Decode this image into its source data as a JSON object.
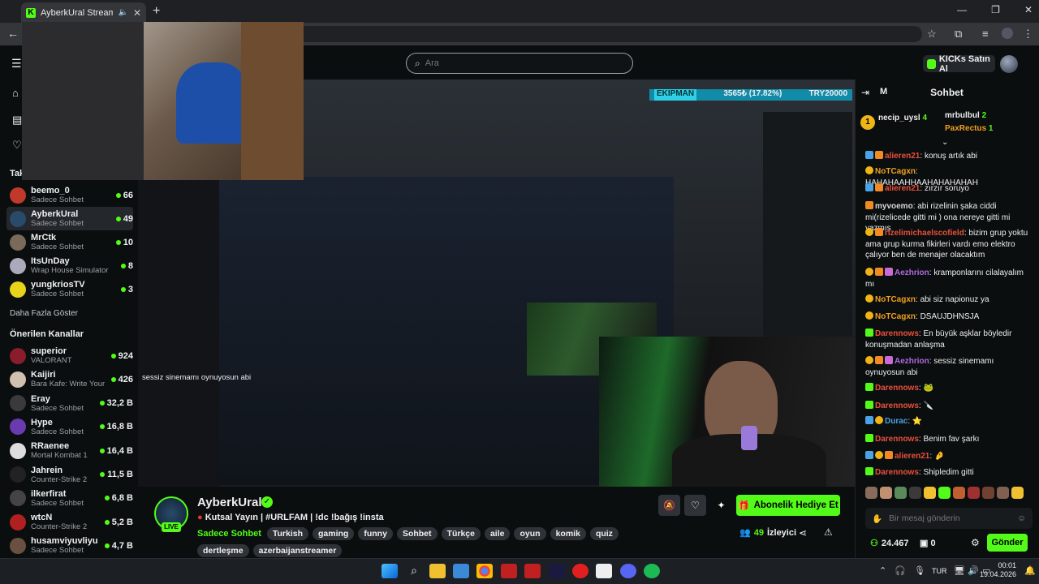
{
  "browser": {
    "tab_title": "AyberkUral Stream - Watch",
    "tab_favicon": "K",
    "new_tab": "+"
  },
  "header": {
    "search_placeholder": "Ara",
    "kicks_label": "KICKs Satın Al"
  },
  "sidebar": {
    "following_title": "Tak",
    "following": [
      {
        "name": "beemo_0",
        "sub": "Sadece Sohbet",
        "viewers": "66",
        "color": "#c0392b"
      },
      {
        "name": "AyberkUral",
        "sub": "Sadece Sohbet",
        "viewers": "49",
        "color": "#2a4a6a"
      },
      {
        "name": "MrCtk",
        "sub": "Sadece Sohbet",
        "viewers": "10",
        "color": "#7a6a5a"
      },
      {
        "name": "ItsUnDay",
        "sub": "Wrap House Simulator",
        "viewers": "8",
        "color": "#aab"
      },
      {
        "name": "yungkriosTV",
        "sub": "Sadece Sohbet",
        "viewers": "3",
        "color": "#e8d21a"
      }
    ],
    "show_more": "Daha Fazla Göster",
    "recommended_title": "Önerilen Kanallar",
    "recommended": [
      {
        "name": "superior",
        "sub": "VALORANT",
        "viewers": "924",
        "color": "#8a1c2c"
      },
      {
        "name": "Kaijiri",
        "sub": "Bara Kafe: Write Your ...",
        "viewers": "426",
        "color": "#cfc0b0"
      },
      {
        "name": "Eray",
        "sub": "Sadece Sohbet",
        "viewers": "32,2 B",
        "color": "#3a3a3a"
      },
      {
        "name": "Hype",
        "sub": "Sadece Sohbet",
        "viewers": "16,8 B",
        "color": "#6a3ab0"
      },
      {
        "name": "RRaenee",
        "sub": "Mortal Kombat 1",
        "viewers": "16,4 B",
        "color": "#ddd"
      },
      {
        "name": "Jahrein",
        "sub": "Counter-Strike 2",
        "viewers": "11,5 B",
        "color": "#222"
      },
      {
        "name": "ilkerfirat",
        "sub": "Sadece Sohbet",
        "viewers": "6,8 B",
        "color": "#444"
      },
      {
        "name": "wtcN",
        "sub": "Counter-Strike 2",
        "viewers": "5,2 B",
        "color": "#b02020"
      },
      {
        "name": "husamviyuvliyu",
        "sub": "Sadece Sohbet",
        "viewers": "4,7 B",
        "color": "#6a5040"
      }
    ]
  },
  "stream": {
    "streamer": "AyberkUral",
    "live": "LIVE",
    "title": "Kutsal Yayın | #URLFAM | !dc !bağış !insta",
    "category": "Sadece Sohbet",
    "tags": [
      "Turkish",
      "gaming",
      "funny",
      "Sohbet",
      "Türkçe",
      "aile",
      "oyun",
      "komik",
      "quiz",
      "dertleşme",
      "azerbaijanstreamer"
    ],
    "subscribe_gift": "Abonelik Hediye Et",
    "viewer_count": "49",
    "viewer_label": "İzleyici"
  },
  "chat": {
    "tab_short": "M",
    "title": "Sohbet",
    "pinned": [
      {
        "user": "necip_uysl",
        "count": "4"
      },
      {
        "user": "mrbulbul",
        "count": "2"
      },
      {
        "user": "PaxRectus",
        "count": "1"
      }
    ],
    "messages": [
      {
        "user": "alieren21",
        "color": "#e9503c",
        "text": "konuş artık abi",
        "badges": [
          "blue",
          "orange"
        ]
      },
      {
        "user": "NoTCagxn",
        "color": "#f0a020",
        "text": "HAHAHAAHHAAHAHAHAHAH",
        "badges": [
          "gold"
        ]
      },
      {
        "user": "alieren21",
        "color": "#e9503c",
        "text": "zırzır soruyo",
        "badges": [
          "blue",
          "orange"
        ]
      },
      {
        "user": "myvoemo",
        "color": "#d8d8d8",
        "text": "abi rizelinin şaka ciddi mi(rizelicede gitti mi ) ona nereye gitti mi yazmış",
        "badges": [
          "orange"
        ]
      },
      {
        "user": "rizelimichaelscofield",
        "color": "#e9503c",
        "text": "bizim grup yoktu ama grup kurma fikirleri vardı emo elektro çalıyor ben de menajer olacaktım",
        "badges": [
          "gold",
          "orange"
        ]
      },
      {
        "user": "Aezhrion",
        "color": "#b06ae0",
        "text": "kramponlarını cilalayalım mı",
        "badges": [
          "gold",
          "orange",
          "pink"
        ]
      },
      {
        "user": "NoTCagxn",
        "color": "#f0a020",
        "text": "abi siz napionuz ya",
        "badges": [
          "gold"
        ]
      },
      {
        "user": "NoTCagxn",
        "color": "#f0a020",
        "text": "DSAUJDHNSJA",
        "badges": [
          "gold"
        ]
      },
      {
        "user": "Darennows",
        "color": "#e9503c",
        "text": "En büyük aşklar böyledir konuşmadan anlaşma",
        "badges": [
          "green"
        ]
      },
      {
        "user": "Aezhrion",
        "color": "#b06ae0",
        "text": "sessiz sinemamı oynuyosun abi",
        "badges": [
          "gold",
          "orange",
          "pink"
        ]
      },
      {
        "user": "Darennows",
        "color": "#e9503c",
        "text": "🐸",
        "badges": [
          "green"
        ]
      },
      {
        "user": "Darennows",
        "color": "#e9503c",
        "text": "🔪",
        "badges": [
          "green"
        ]
      },
      {
        "user": "Durac",
        "color": "#4aa3e6",
        "text": "⭐",
        "badges": [
          "blue",
          "gold"
        ]
      },
      {
        "user": "Darennows",
        "color": "#e9503c",
        "text": "Benim fav şarkı",
        "badges": [
          "green"
        ]
      },
      {
        "user": "alieren21",
        "color": "#e9503c",
        "text": "🤌",
        "badges": [
          "blue",
          "gold",
          "orange"
        ]
      },
      {
        "user": "Darennows",
        "color": "#e9503c",
        "text": "Shipledim gitti",
        "badges": [
          "green"
        ]
      }
    ],
    "input_placeholder": "Bir mesaj gönderin",
    "points": "24.467",
    "zero": "0",
    "send": "Gönder"
  },
  "overlay": {
    "ticker_name": "EKIPMAN",
    "ticker_value": "3565₺ (17.82%)",
    "ticker_goal": "TRY20000",
    "caption": "sessiz sinemamı oynuyosun abi"
  },
  "taskbar": {
    "lang": "TUR",
    "time": "00:01",
    "date": "19.04.2026"
  },
  "colors": {
    "accent": "#53fc18",
    "bg": "#0b0e0f"
  }
}
